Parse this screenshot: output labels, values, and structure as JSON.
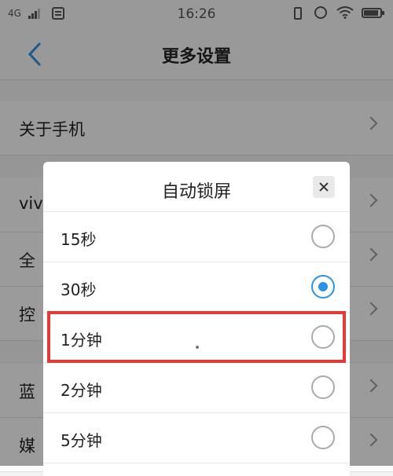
{
  "status_bar": {
    "network": "4G",
    "time": "16:26"
  },
  "header": {
    "title": "更多设置",
    "back_icon": "chevron-left-icon"
  },
  "settings_list": [
    {
      "label": "关于手机"
    },
    {
      "label": "viv"
    },
    {
      "label": "全"
    },
    {
      "label": "控"
    },
    {
      "label": "蓝"
    },
    {
      "label": "媒"
    }
  ],
  "dialog": {
    "title": "自动锁屏",
    "close_icon": "close-icon",
    "options": [
      {
        "label": "15秒",
        "selected": false
      },
      {
        "label": "30秒",
        "selected": true
      },
      {
        "label": "1分钟",
        "selected": false
      },
      {
        "label": "2分钟",
        "selected": false
      },
      {
        "label": "5分钟",
        "selected": false
      }
    ]
  },
  "colors": {
    "accent": "#2a93e6",
    "highlight": "#e53935"
  }
}
